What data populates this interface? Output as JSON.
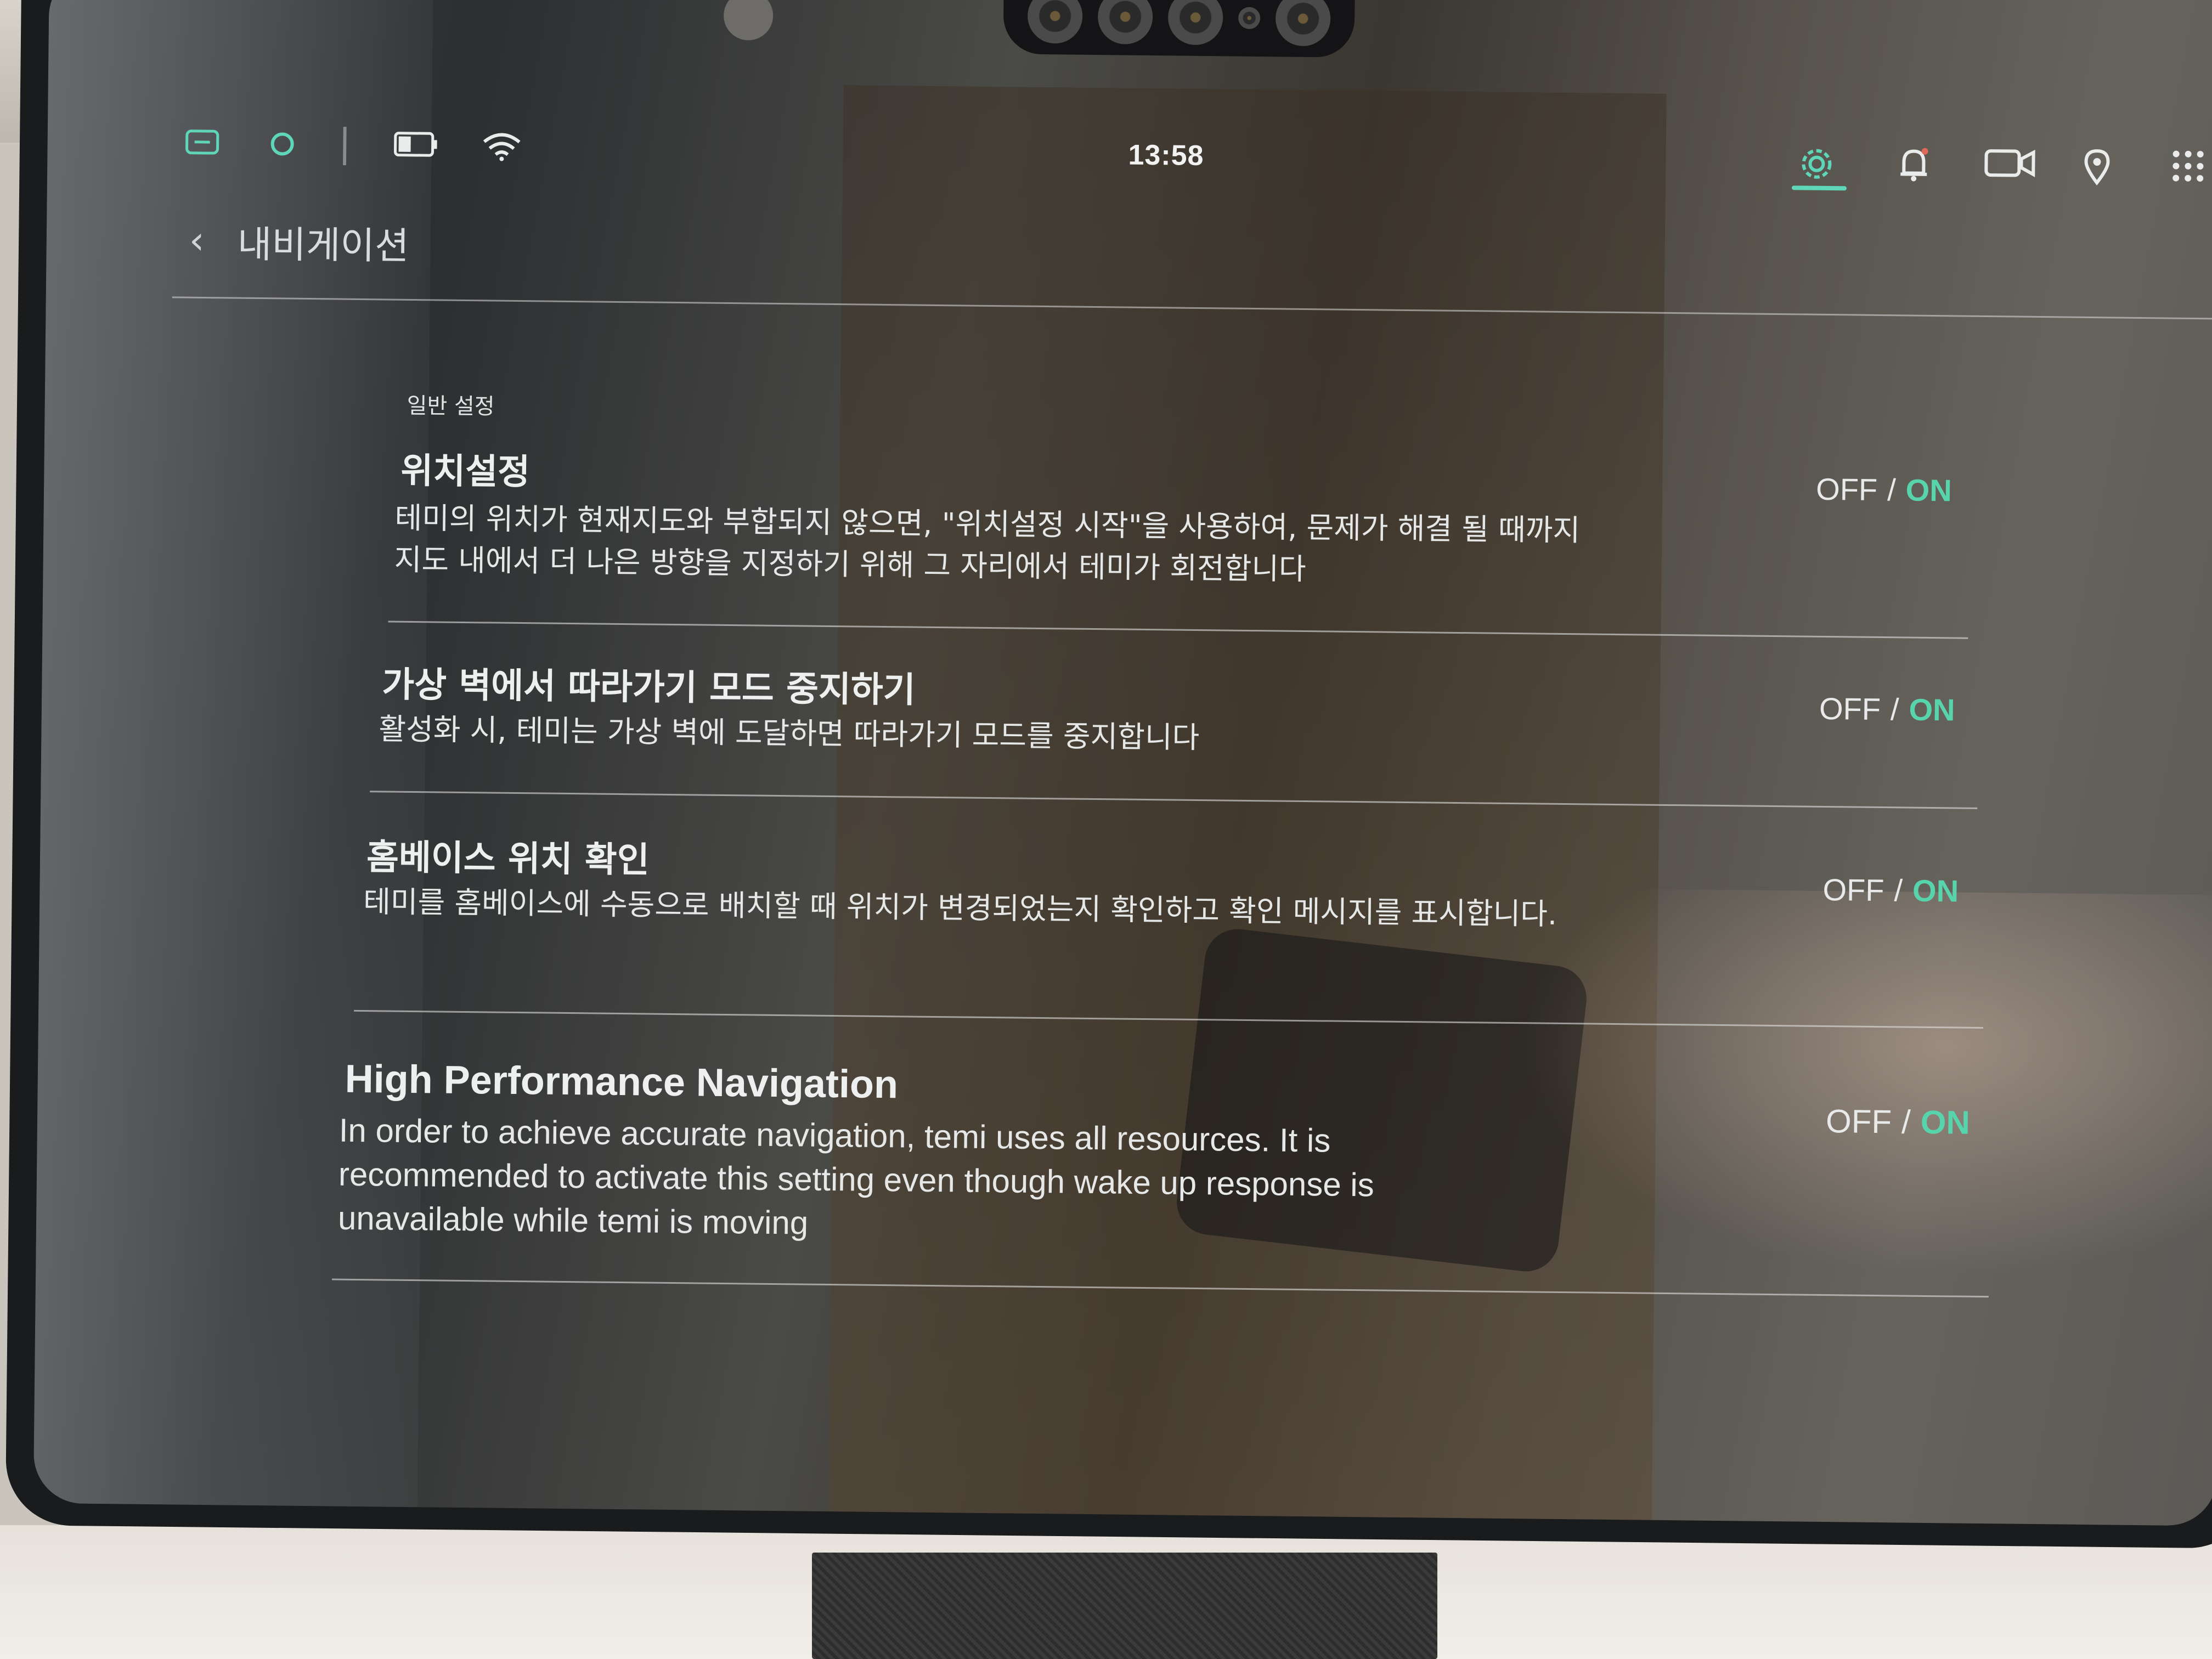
{
  "statusbar": {
    "time": "13:58",
    "accent_color": "#5fd6b7",
    "left_icons": [
      "screen-icon",
      "assistant-ring-icon",
      "battery-icon",
      "wifi-icon"
    ],
    "right_icons": [
      "gear-icon",
      "bell-icon",
      "video-camera-icon",
      "location-pin-icon",
      "apps-grid-icon"
    ]
  },
  "header": {
    "back_glyph": "‹",
    "title": "내비게이션"
  },
  "section": {
    "label": "일반 설정"
  },
  "settings": [
    {
      "title": "위치설정",
      "description": "테미의 위치가 현재지도와 부합되지 않으면, \"위치설정 시작\"을 사용하여, 문제가 해결 될 때까지 지도 내에서 더 나은 방향을 지정하기 위해 그 자리에서 테미가 회전합니다",
      "toggle_off": "OFF",
      "toggle_sep": "/",
      "toggle_on": "ON",
      "state": "ON"
    },
    {
      "title": "가상 벽에서 따라가기 모드 중지하기",
      "description": "활성화 시, 테미는 가상 벽에 도달하면 따라가기 모드를 중지합니다",
      "toggle_off": "OFF",
      "toggle_sep": "/",
      "toggle_on": "ON",
      "state": "ON"
    },
    {
      "title": "홈베이스 위치 확인",
      "description": "테미를 홈베이스에 수동으로 배치할 때 위치가 변경되었는지 확인하고 확인 메시지를 표시합니다.",
      "toggle_off": "OFF",
      "toggle_sep": "/",
      "toggle_on": "ON",
      "state": "ON"
    },
    {
      "title": "High Performance Navigation",
      "description": "In order to achieve accurate navigation, temi uses all resources. It is recommended to activate this setting even though wake up response is unavailable while temi is moving",
      "toggle_off": "OFF",
      "toggle_sep": "/",
      "toggle_on": "ON",
      "state": "ON"
    }
  ]
}
